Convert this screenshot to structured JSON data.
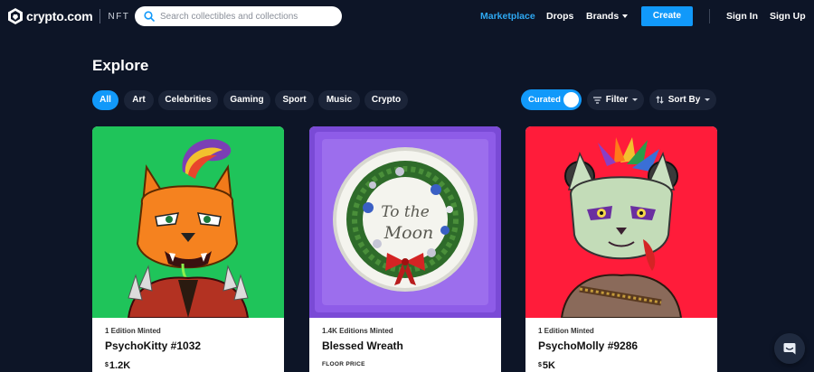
{
  "brand": {
    "name": "crypto.com",
    "product": "NFT"
  },
  "search": {
    "placeholder": "Search collectibles and collections"
  },
  "nav": {
    "marketplace": "Marketplace",
    "drops": "Drops",
    "brands": "Brands",
    "create": "Create",
    "sign_in": "Sign In",
    "sign_up": "Sign Up"
  },
  "page": {
    "title": "Explore"
  },
  "filters": [
    "All",
    "Art",
    "Celebrities",
    "Gaming",
    "Sport",
    "Music",
    "Crypto"
  ],
  "controls": {
    "curated": "Curated",
    "filter": "Filter",
    "sort": "Sort By"
  },
  "cards": [
    {
      "edition": "1 Edition Minted",
      "title": "PsychoKitty #1032",
      "currency": "$",
      "price": "1.2K"
    },
    {
      "edition": "1.4K Editions Minted",
      "title": "Blessed Wreath",
      "floor_label": "FLOOR PRICE",
      "art_text_1": "To the",
      "art_text_2": "Moon"
    },
    {
      "edition": "1 Edition Minted",
      "title": "PsychoMolly #9286",
      "currency": "$",
      "price": "5K"
    }
  ],
  "colors": {
    "background": "#0d1527",
    "accent": "#1199fa",
    "active_link": "#2ea8f2"
  }
}
